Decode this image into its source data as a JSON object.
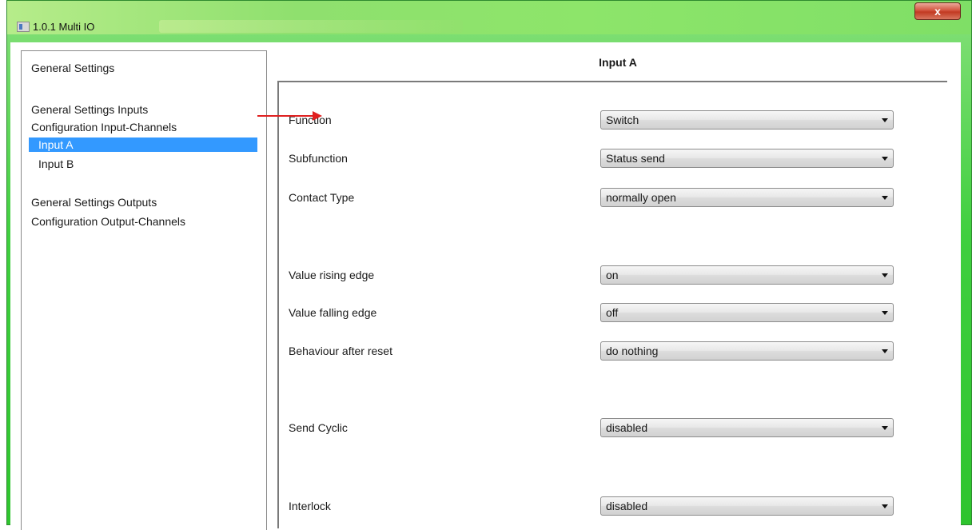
{
  "window": {
    "title": "1.0.1 Multi IO",
    "close_label": "x",
    "accent_color": "#3fcf3f"
  },
  "tree": {
    "items": [
      {
        "label": "General Settings"
      },
      {
        "label": "General Settings Inputs"
      },
      {
        "label": "Configuration Input-Channels"
      },
      {
        "label": "Input  A",
        "selected": true
      },
      {
        "label": "Input  B"
      },
      {
        "label": "General Settings Outputs"
      },
      {
        "label": "Configuration Output-Channels"
      }
    ],
    "selection_color": "#3399ff"
  },
  "panel": {
    "title": "Input  A",
    "params": [
      {
        "label": "Function",
        "value": "Switch"
      },
      {
        "label": "Subfunction",
        "value": "Status send",
        "highlighted": true
      },
      {
        "label": "Contact Type",
        "value": "normally open"
      },
      {
        "label": "Value rising edge",
        "value": "on"
      },
      {
        "label": "Value falling edge",
        "value": "off"
      },
      {
        "label": "Behaviour after reset",
        "value": "do nothing"
      },
      {
        "label": "Send Cyclic",
        "value": "disabled"
      },
      {
        "label": "Interlock",
        "value": "disabled"
      }
    ]
  },
  "annotation": {
    "arrow_color": "#e02020",
    "arrow_icon": "red-arrow-icon"
  }
}
